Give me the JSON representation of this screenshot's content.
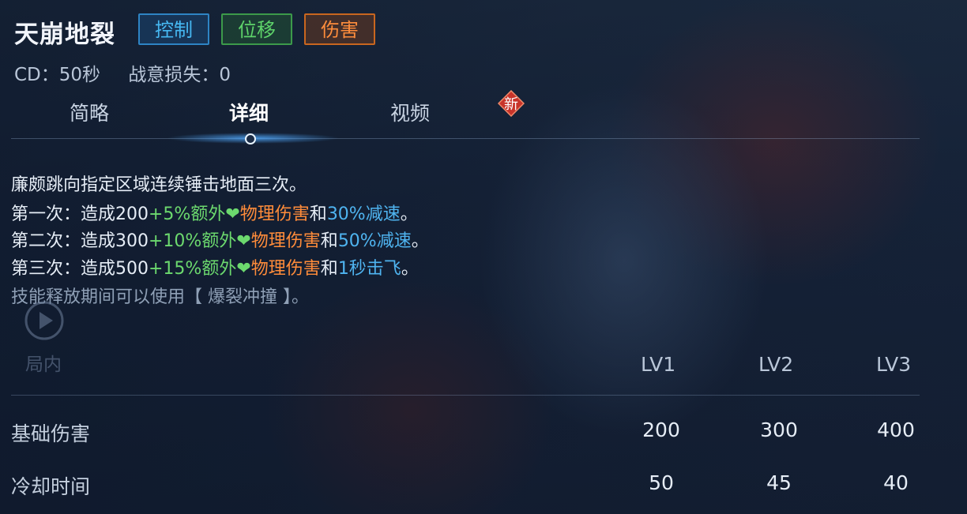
{
  "skill": {
    "name": "天崩地裂",
    "tags": [
      {
        "label": "控制",
        "color": "#46b8f2"
      },
      {
        "label": "位移",
        "color": "#5ed36a"
      },
      {
        "label": "伤害",
        "color": "#ff8d3c"
      }
    ],
    "cd": "CD：50秒",
    "morale_loss": "战意损失：0"
  },
  "tabs": [
    {
      "label": "简略",
      "active": false
    },
    {
      "label": "详细",
      "active": true
    },
    {
      "label": "视频",
      "active": false
    }
  ],
  "new_badge": "新",
  "description": {
    "line1": "廉颇跳向指定区域连续锤击地面三次。",
    "line2": {
      "a": "第一次：造成200",
      "b": "+5%额外",
      "c": "物理伤害",
      "d": "和",
      "e": "30%减速",
      "f": "。"
    },
    "line3": {
      "a": "第二次：造成300",
      "b": "+10%额外",
      "c": "物理伤害",
      "d": "和",
      "e": "50%减速",
      "f": "。"
    },
    "line4": {
      "a": "第三次：造成500",
      "b": "+15%额外",
      "c": "物理伤害",
      "d": "和",
      "e": "1秒击飞",
      "f": "。"
    },
    "line5": "技能释放期间可以使用【 爆裂冲撞 】。"
  },
  "side_menu": {
    "label": "局内"
  },
  "stats_table": {
    "levels": [
      "LV1",
      "LV2",
      "LV3"
    ],
    "rows": [
      {
        "label": "基础伤害",
        "values": [
          "200",
          "300",
          "400"
        ]
      },
      {
        "label": "冷却时间",
        "values": [
          "50",
          "45",
          "40"
        ]
      }
    ]
  },
  "colors": {
    "green": "#6cd96e",
    "orange": "#ff8c3a",
    "blue": "#4fb4f0",
    "badge_red": "#c8342a"
  },
  "icons": [
    "heart-icon",
    "new-badge-icon",
    "play-icon"
  ]
}
